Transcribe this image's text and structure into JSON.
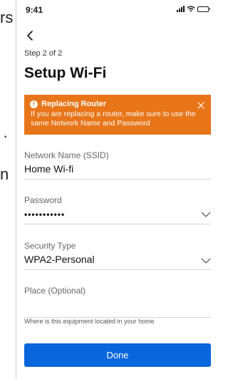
{
  "background_fragments": [
    "rs",
    "·",
    "n"
  ],
  "status_bar": {
    "time": "9:41",
    "icons": [
      "signal-icon",
      "wifi-icon",
      "battery-icon"
    ]
  },
  "nav": {
    "back_icon": "chevron-left-icon"
  },
  "header": {
    "step": "Step 2 of 2",
    "title": "Setup Wi-Fi"
  },
  "alert": {
    "title": "Replacing Router",
    "message": "If you are replacing a router, make sure to use the same Network Name and Password",
    "color": "#e87518"
  },
  "form": {
    "ssid": {
      "label": "Network Name (SSID)",
      "value": "Home Wi-fi"
    },
    "password": {
      "label": "Password",
      "value": "•••••••••••"
    },
    "security": {
      "label": "Security Type",
      "value": "WPA2-Personal"
    },
    "place": {
      "label": "Place (Optional)",
      "value": "",
      "hint": "Where is this equipment located in your home"
    }
  },
  "actions": {
    "done_label": "Done",
    "accent": "#0a66dd"
  }
}
